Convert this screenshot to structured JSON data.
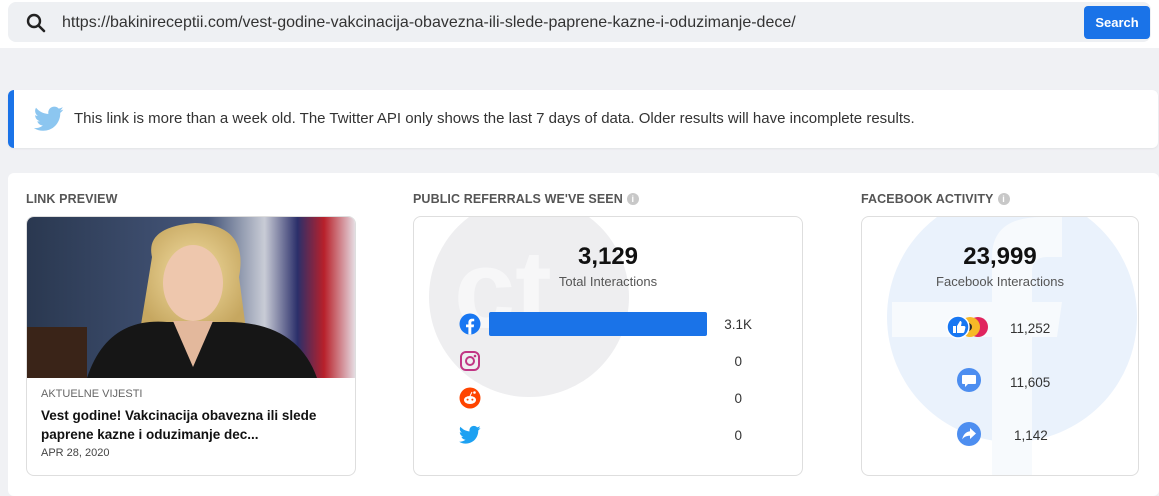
{
  "search": {
    "url": "https://bakinireceptii.com/vest-godine-vakcinacija-obavezna-ili-slede-paprene-kazne-i-oduzimanje-dece/",
    "button_label": "Search"
  },
  "notice": {
    "text": "This link is more than a week old. The Twitter API only shows the last 7 days of data. Older results will have incomplete results."
  },
  "link_preview": {
    "section_title": "LINK PREVIEW",
    "category": "AKTUELNE VIJESTI",
    "title": "Vest godine! Vakcinacija obavezna ili slede paprene kazne i oduzimanje dec...",
    "date": "APR 28, 2020"
  },
  "referrals": {
    "section_title": "PUBLIC REFERRALS WE'VE SEEN",
    "total": "3,129",
    "total_label": "Total Interactions",
    "rows": [
      {
        "platform": "facebook",
        "icon": "facebook-icon",
        "value": "3.1K",
        "fraction": 1.0
      },
      {
        "platform": "instagram",
        "icon": "instagram-icon",
        "value": "0",
        "fraction": 0
      },
      {
        "platform": "reddit",
        "icon": "reddit-icon",
        "value": "0",
        "fraction": 0
      },
      {
        "platform": "twitter",
        "icon": "twitter-icon",
        "value": "0",
        "fraction": 0
      }
    ]
  },
  "facebook_activity": {
    "section_title": "FACEBOOK ACTIVITY",
    "total": "23,999",
    "total_label": "Facebook Interactions",
    "rows": [
      {
        "type": "reactions",
        "icon": "reactions-icon",
        "value": "11,252"
      },
      {
        "type": "comments",
        "icon": "comment-icon",
        "value": "11,605"
      },
      {
        "type": "shares",
        "icon": "share-icon",
        "value": "1,142"
      }
    ]
  },
  "colors": {
    "accent": "#1a73e8",
    "facebook": "#1877f2",
    "instagram": "#c13584",
    "reddit": "#ff4500",
    "twitter": "#1da1f2"
  }
}
